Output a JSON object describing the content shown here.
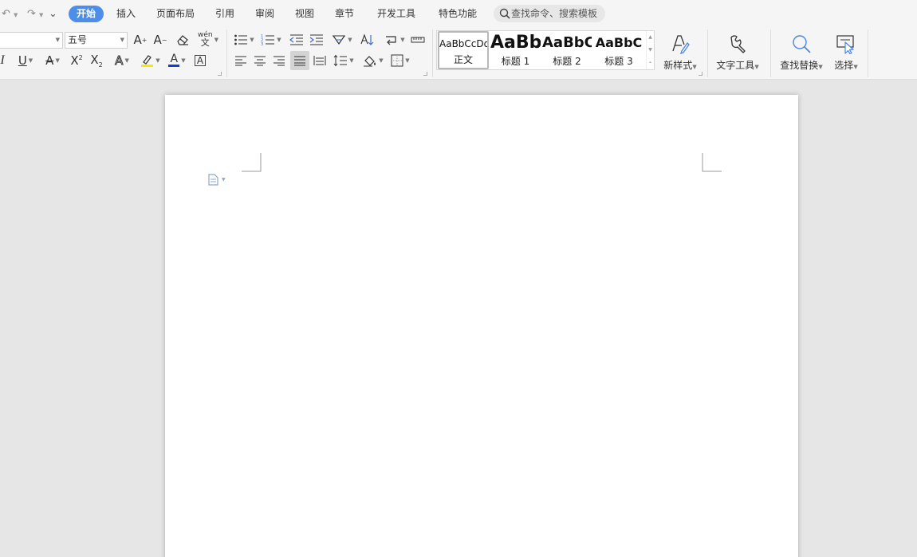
{
  "quick_access": {
    "undo": "↶",
    "redo": "↷",
    "more": "⌄"
  },
  "tabs": [
    {
      "label": "开始",
      "active": true
    },
    {
      "label": "插入"
    },
    {
      "label": "页面布局"
    },
    {
      "label": "引用"
    },
    {
      "label": "审阅"
    },
    {
      "label": "视图"
    },
    {
      "label": "章节"
    },
    {
      "label": "开发工具"
    },
    {
      "label": "特色功能"
    }
  ],
  "search": {
    "placeholder": "查找命令、搜索模板"
  },
  "font": {
    "family_value": "",
    "size_value": "五号",
    "grow": "A",
    "shrink": "A",
    "phonetic": "wén",
    "italic": "I",
    "underline": "U",
    "strike": "A",
    "superscript": "X",
    "subscript": "X",
    "effects": "A",
    "highlight": "",
    "font_color": "A",
    "char_border": "A"
  },
  "styles": {
    "items": [
      {
        "sample": "AaBbCcDd",
        "name": "正文",
        "selected": true
      },
      {
        "sample": "AaBb",
        "name": "标题 1"
      },
      {
        "sample": "AaBbC",
        "name": "标题 2"
      },
      {
        "sample": "AaBbC",
        "name": "标题 3"
      }
    ]
  },
  "buttons": {
    "new_style": "新样式",
    "text_tools": "文字工具",
    "find_replace": "查找替换",
    "select": "选择"
  },
  "colors": {
    "accent": "#4d8ee8",
    "highlight": "#ffe600",
    "font_color": "#1a3ccc",
    "icon_blue": "#4a86e8"
  }
}
